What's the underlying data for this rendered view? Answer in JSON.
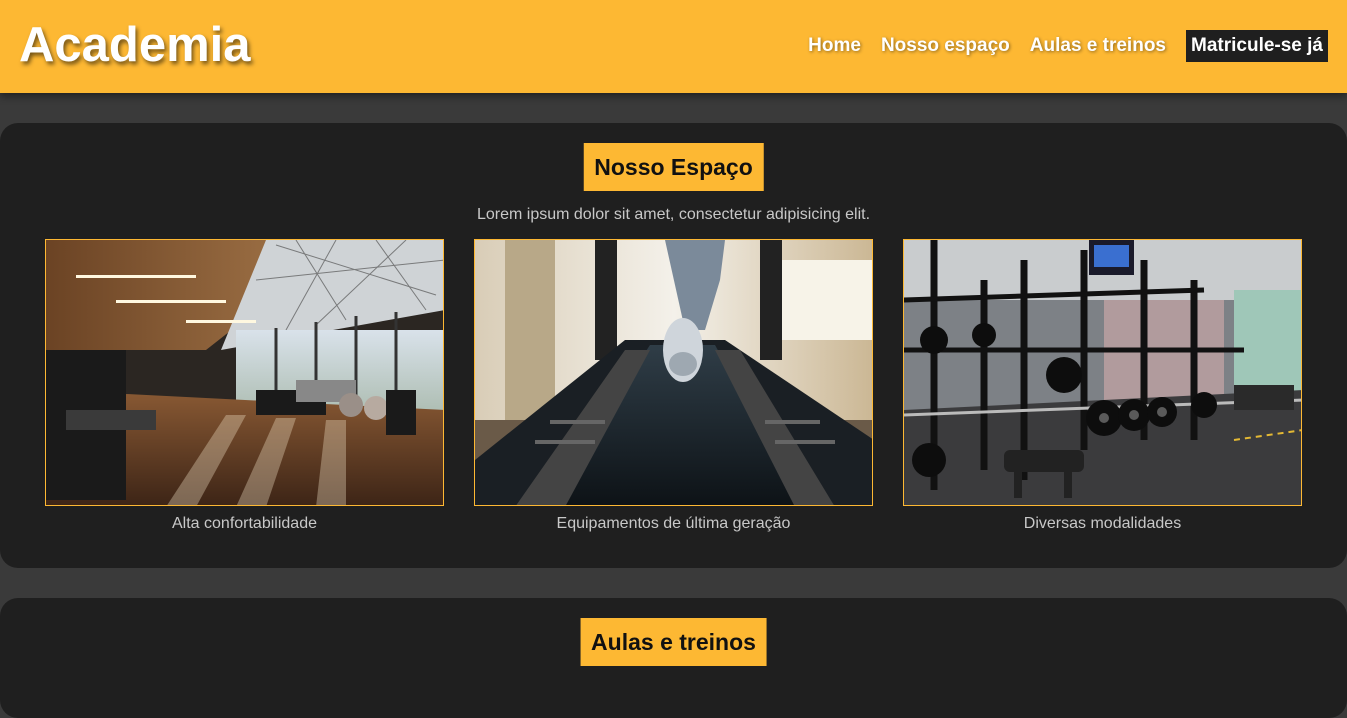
{
  "header": {
    "logo": "Academia",
    "nav": [
      {
        "label": "Home"
      },
      {
        "label": "Nosso espaço"
      },
      {
        "label": "Aulas e treinos"
      },
      {
        "label": "Matricule-se já"
      }
    ]
  },
  "space_section": {
    "title": "Nosso Espaço",
    "description": "Lorem ipsum dolor sit amet, consectetur adipisicing elit.",
    "cards": [
      {
        "caption": "Alta confortabilidade",
        "image": "gym-interior-photo"
      },
      {
        "caption": "Equipamentos de última geração",
        "image": "treadmill-photo"
      },
      {
        "caption": "Diversas modalidades",
        "image": "weight-racks-photo"
      }
    ]
  },
  "classes_section": {
    "title": "Aulas e treinos"
  },
  "colors": {
    "accent": "#fdb833",
    "panel": "#1f1f1f",
    "page_background": "#3a3a3a",
    "text_light": "#c8c8c8"
  }
}
